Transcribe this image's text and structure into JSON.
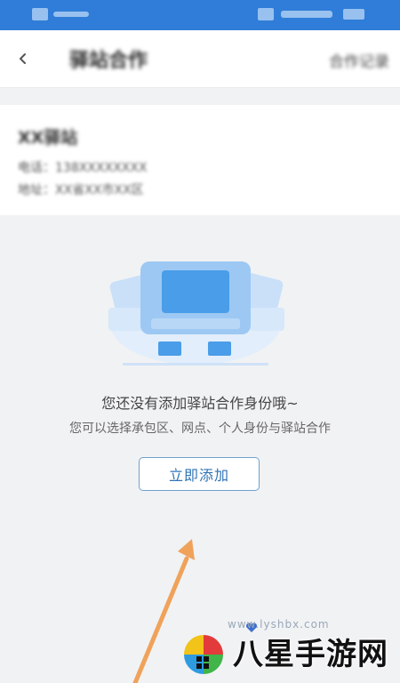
{
  "nav": {
    "back_icon": "chevron-left-icon",
    "title": "驿站合作",
    "action": "合作记录"
  },
  "station": {
    "name": "XX驿站",
    "phone_line": "电话：138XXXXXXXX",
    "address_line": "地址：XX省XX市XX区"
  },
  "empty_state": {
    "illustration": "computer-illustration",
    "title": "您还没有添加驿站合作身份哦~",
    "subtitle": "您可以选择承包区、网点、个人身份与驿站合作",
    "add_button_label": "立即添加"
  },
  "watermark": {
    "brand_text": "八星手游网",
    "url": "www.lyshbx.com"
  },
  "colors": {
    "status_bar": "#2f7dd8",
    "accent": "#2f73b6",
    "arrow": "#f0a25a"
  }
}
